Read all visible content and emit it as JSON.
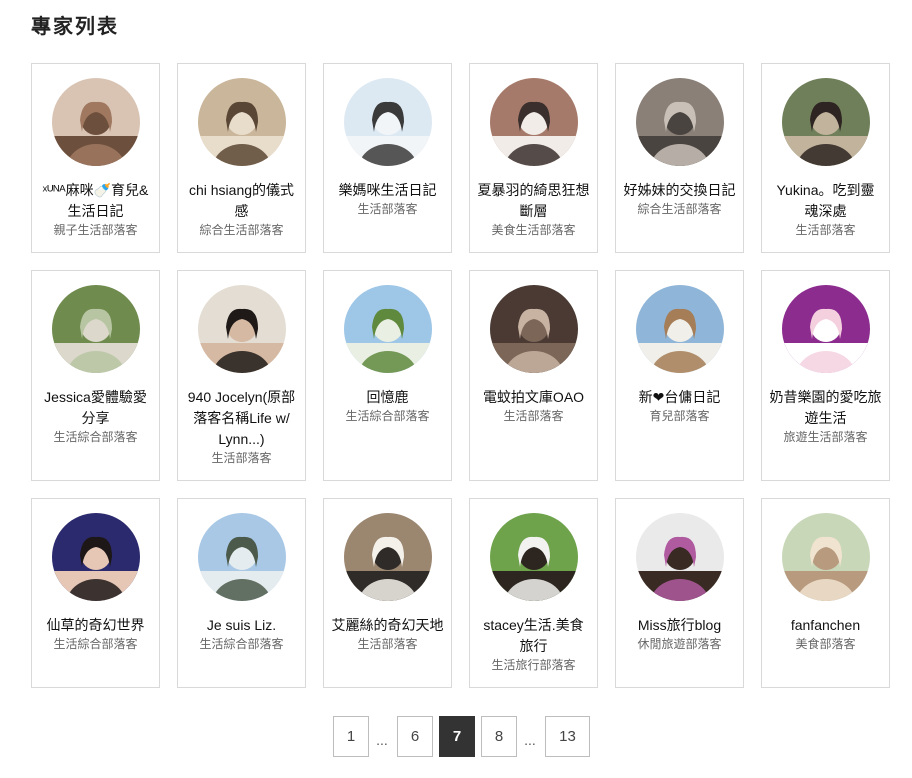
{
  "page": {
    "title": "專家列表"
  },
  "experts": [
    {
      "name": "ˣᵁᴺᴬ麻咪🍼育兒&生活日記",
      "category": "親子生活部落客",
      "avatar_colors": [
        "#d9c4b4",
        "#a07860",
        "#6d4f3d"
      ]
    },
    {
      "name": "chi hsiang的儀式感",
      "category": "綜合生活部落客",
      "avatar_colors": [
        "#c9b69b",
        "#5a4634",
        "#e8dccb"
      ]
    },
    {
      "name": "樂媽咪生活日記",
      "category": "生活部落客",
      "avatar_colors": [
        "#dde9f2",
        "#3b3a3a",
        "#f2f5f7"
      ]
    },
    {
      "name": "夏暴羽的綺思狂想斷層",
      "category": "美食生活部落客",
      "avatar_colors": [
        "#a67a6a",
        "#3a2f2c",
        "#f1ece7"
      ]
    },
    {
      "name": "好姊妹的交換日記",
      "category": "綜合生活部落客",
      "avatar_colors": [
        "#8a8078",
        "#c9c1b8",
        "#4a4440"
      ]
    },
    {
      "name": "Yukina。吃到靈魂深處",
      "category": "生活部落客",
      "avatar_colors": [
        "#6f7f5a",
        "#2e2422",
        "#c2b39c"
      ]
    },
    {
      "name": "Jessica愛體驗愛分享",
      "category": "生活綜合部落客",
      "avatar_colors": [
        "#6f8b4e",
        "#b7c5a2",
        "#dcd8cc"
      ]
    },
    {
      "name": "940 Jocelyn(原部落客名稱Life w/ Lynn...)",
      "category": "生活部落客",
      "avatar_colors": [
        "#e4ddd3",
        "#1f1a18",
        "#d5b9a2"
      ]
    },
    {
      "name": "回憶鹿",
      "category": "生活綜合部落客",
      "avatar_colors": [
        "#9ec6e6",
        "#5f8a3e",
        "#e9efe2"
      ]
    },
    {
      "name": "電蚊拍文庫OAO",
      "category": "生活部落客",
      "avatar_colors": [
        "#4a3a33",
        "#c8b3a2",
        "#7b6658"
      ]
    },
    {
      "name": "新❤台傭日記",
      "category": "育兒部落客",
      "avatar_colors": [
        "#8fb5d8",
        "#a57d56",
        "#f0efe9"
      ]
    },
    {
      "name": "奶昔樂園的愛吃旅遊生活",
      "category": "旅遊生活部落客",
      "avatar_colors": [
        "#8b2c8e",
        "#f4d0df",
        "#ffffff"
      ]
    },
    {
      "name": "仙草的奇幻世界",
      "category": "生活綜合部落客",
      "avatar_colors": [
        "#2c2a6e",
        "#1d1717",
        "#e6c7b5"
      ]
    },
    {
      "name": "Je suis Liz.",
      "category": "生活綜合部落客",
      "avatar_colors": [
        "#a8c8e6",
        "#4b5a4a",
        "#e5ecef"
      ]
    },
    {
      "name": "艾麗絲的奇幻天地",
      "category": "生活部落客",
      "avatar_colors": [
        "#9b8670",
        "#f4f1ea",
        "#2f2b29"
      ]
    },
    {
      "name": "stacey生活.美食旅行",
      "category": "生活旅行部落客",
      "avatar_colors": [
        "#6ea34b",
        "#f2f2f0",
        "#2d2620"
      ]
    },
    {
      "name": "Miss旅行blog",
      "category": "休閒旅遊部落客",
      "avatar_colors": [
        "#eaeaea",
        "#b05aa0",
        "#3a2a24"
      ]
    },
    {
      "name": "fanfanchen",
      "category": "美食部落客",
      "avatar_colors": [
        "#c9d7b9",
        "#f0e3cf",
        "#b89a7f"
      ]
    }
  ],
  "pagination": {
    "first": "1",
    "ellipsis_left": "...",
    "prev": "6",
    "current": "7",
    "next": "8",
    "ellipsis_right": "...",
    "last": "13"
  }
}
